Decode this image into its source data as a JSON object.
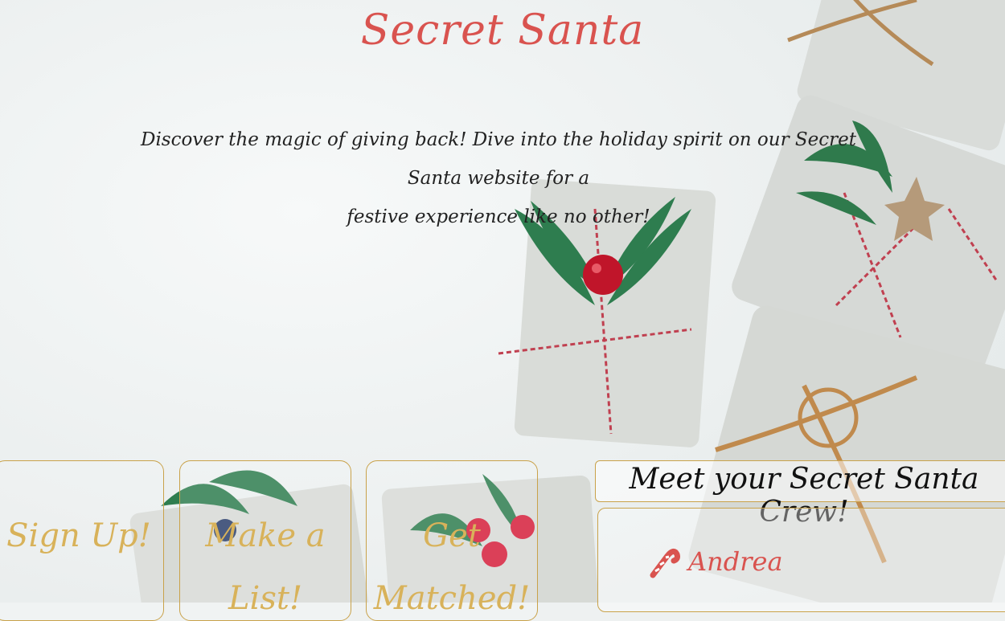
{
  "header": {
    "title": "Secret Santa",
    "tagline_line1": "Discover the magic of giving back! Dive into the holiday spirit on our Secret Santa website for a",
    "tagline_line2": "festive experience like no other!"
  },
  "steps": [
    {
      "line1": "Sign Up!",
      "line2": ""
    },
    {
      "line1": "Make a",
      "line2": "List!"
    },
    {
      "line1": "Get",
      "line2": "Matched!"
    }
  ],
  "crew": {
    "heading": "Meet your Secret Santa Crew!",
    "members": [
      {
        "name": "Andrea",
        "icon": "candy-cane-icon"
      }
    ]
  },
  "colors": {
    "title": "#d9534f",
    "gold_accent": "#c9a24a",
    "gift_paper": "#dcdedb",
    "pine": "#2e7d4f",
    "berry": "#c0152a"
  }
}
